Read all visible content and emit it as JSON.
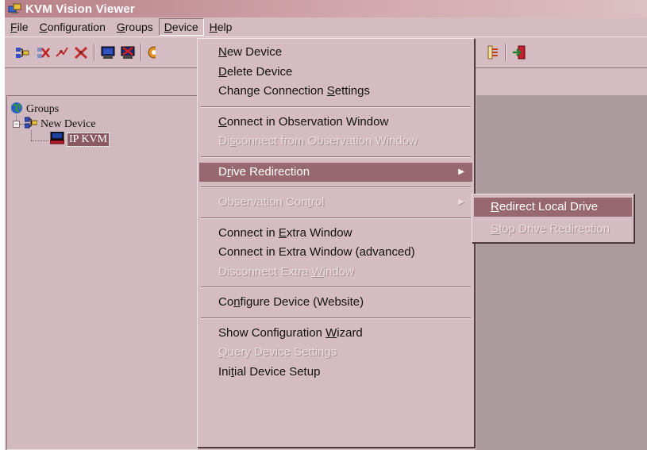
{
  "window": {
    "title": "KVM Vision Viewer",
    "icon": "kvm-app-icon"
  },
  "menubar": [
    {
      "key": "file",
      "label": "File",
      "mnemonic_index": 0
    },
    {
      "key": "configuration",
      "label": "Configuration",
      "mnemonic_index": 0
    },
    {
      "key": "groups",
      "label": "Groups",
      "mnemonic_index": 0
    },
    {
      "key": "device",
      "label": "Device",
      "mnemonic_index": 0,
      "active": true
    },
    {
      "key": "help",
      "label": "Help",
      "mnemonic_index": 0
    }
  ],
  "toolbar": {
    "icons": [
      "new-device-icon",
      "delete-device-icon",
      "connect-icon",
      "disconnect-icon",
      "monitor-icon",
      "monitor-close-icon",
      "options-icon",
      "tree-icon",
      "exit-icon"
    ]
  },
  "tree": {
    "groups_label": "Groups",
    "device_label": "New Device",
    "kvm_label": "IP KVM"
  },
  "device_menu": [
    {
      "label": "New Device",
      "mnemonic_index": 0,
      "state": "enabled"
    },
    {
      "label": "Delete Device",
      "mnemonic_index": 0,
      "state": "enabled"
    },
    {
      "label": "Change Connection Settings",
      "mnemonic_index": 18,
      "state": "enabled"
    },
    {
      "separator": true
    },
    {
      "label": "Connect in Observation Window",
      "mnemonic_index": 0,
      "state": "enabled"
    },
    {
      "label": "Disconnect from Observation Window",
      "mnemonic_index": 2,
      "state": "disabled"
    },
    {
      "separator": true
    },
    {
      "label": "Drive Redirection",
      "mnemonic_index": 1,
      "state": "highlighted",
      "submenu": true
    },
    {
      "separator": true
    },
    {
      "label": "Observation Control",
      "mnemonic_index": 15,
      "state": "disabled",
      "submenu": true
    },
    {
      "separator": true
    },
    {
      "label": "Connect in Extra Window",
      "mnemonic_index": 11,
      "state": "enabled"
    },
    {
      "label": "Connect in Extra Window (advanced)",
      "mnemonic_index": -1,
      "state": "enabled"
    },
    {
      "label": "Disconnect Extra Window",
      "mnemonic_index": 17,
      "state": "disabled"
    },
    {
      "separator": true
    },
    {
      "label": "Configure Device (Website)",
      "mnemonic_index": 2,
      "state": "enabled"
    },
    {
      "separator": true
    },
    {
      "label": "Show Configuration Wizard",
      "mnemonic_index": 19,
      "state": "enabled"
    },
    {
      "label": "Query Device Settings",
      "mnemonic_index": 0,
      "state": "disabled"
    },
    {
      "label": "Initial Device Setup",
      "mnemonic_index": 3,
      "state": "enabled"
    }
  ],
  "drive_submenu": [
    {
      "label": "Redirect Local Drive",
      "mnemonic_index": 0,
      "state": "highlighted"
    },
    {
      "label": "Stop Drive Redirection",
      "mnemonic_index": 0,
      "state": "disabled"
    }
  ],
  "colors": {
    "face": "#d4bcc2",
    "highlight": "#986870",
    "tree_selection": "#8a5a64",
    "workspace": "#ab9a9e"
  }
}
